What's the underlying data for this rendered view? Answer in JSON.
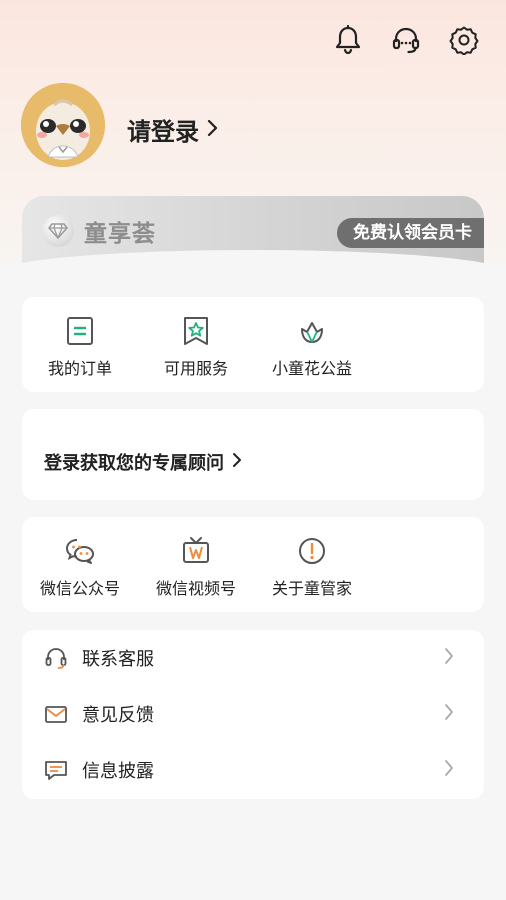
{
  "header": {
    "icons": [
      "bell-icon",
      "headset-icon",
      "settings-icon"
    ]
  },
  "profile": {
    "login_text": "请登录"
  },
  "vip": {
    "brand": "童享荟",
    "claim_button": "免费认领会员卡"
  },
  "quick_actions": [
    {
      "label": "我的订单",
      "icon": "order-icon"
    },
    {
      "label": "可用服务",
      "icon": "service-star-icon"
    },
    {
      "label": "小童花公益",
      "icon": "flower-icon"
    }
  ],
  "advisor": {
    "text": "登录获取您的专属顾问"
  },
  "social": [
    {
      "label": "微信公众号",
      "icon": "wechat-icon"
    },
    {
      "label": "微信视频号",
      "icon": "video-channel-icon"
    },
    {
      "label": "关于童管家",
      "icon": "info-icon"
    }
  ],
  "menu": [
    {
      "label": "联系客服",
      "icon": "headset-icon"
    },
    {
      "label": "意见反馈",
      "icon": "mail-icon"
    },
    {
      "label": "信息披露",
      "icon": "message-icon"
    }
  ],
  "colors": {
    "accent": "#1fb57a",
    "icon_gray": "#666666"
  }
}
